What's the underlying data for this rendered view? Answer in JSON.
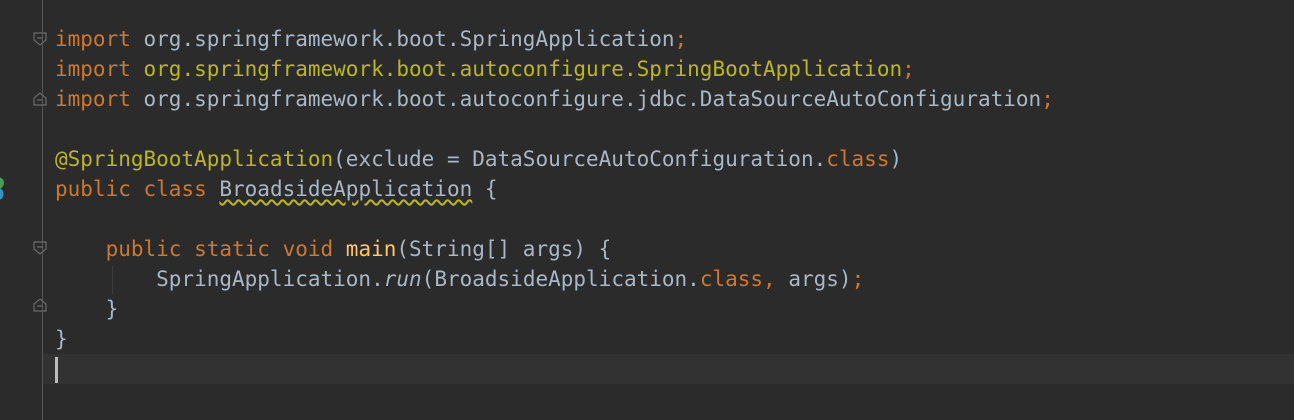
{
  "editor": {
    "lines": [
      {
        "id": "import1",
        "parts": [
          {
            "cls": "kw",
            "text": "import "
          },
          {
            "cls": "sym",
            "text": "org.springframework.boot.SpringApplication"
          },
          {
            "cls": "kw",
            "text": ";"
          }
        ]
      },
      {
        "id": "import2",
        "parts": [
          {
            "cls": "kw",
            "text": "import "
          },
          {
            "cls": "import-highlight",
            "text": "org.springframework.boot.autoconfigure.SpringBootApplication"
          },
          {
            "cls": "kw",
            "text": ";"
          }
        ]
      },
      {
        "id": "import3",
        "parts": [
          {
            "cls": "kw",
            "text": "import "
          },
          {
            "cls": "sym",
            "text": "org.springframework.boot.autoconfigure.jdbc.DataSourceAutoConfiguration"
          },
          {
            "cls": "kw",
            "text": ";"
          }
        ]
      },
      {
        "id": "blank1",
        "parts": []
      },
      {
        "id": "annotation",
        "parts": [
          {
            "cls": "ann",
            "text": "@SpringBootApplication"
          },
          {
            "cls": "sym",
            "text": "(exclude = DataSourceAutoConfiguration."
          },
          {
            "cls": "kw",
            "text": "class"
          },
          {
            "cls": "sym",
            "text": ")"
          }
        ]
      },
      {
        "id": "class-decl",
        "parts": [
          {
            "cls": "kw",
            "text": "public class "
          },
          {
            "cls": "sym warn",
            "text": "BroadsideApplication"
          },
          {
            "cls": "sym",
            "text": " {"
          }
        ]
      },
      {
        "id": "blank2",
        "parts": []
      },
      {
        "id": "main-decl",
        "parts": [
          {
            "cls": "sym",
            "text": "    "
          },
          {
            "cls": "kw",
            "text": "public static void "
          },
          {
            "cls": "method",
            "text": "main"
          },
          {
            "cls": "sym",
            "text": "(String[] args) {"
          }
        ]
      },
      {
        "id": "run-call",
        "parts": [
          {
            "cls": "sym",
            "text": "        SpringApplication."
          },
          {
            "cls": "static-call",
            "text": "run"
          },
          {
            "cls": "sym",
            "text": "(BroadsideApplication."
          },
          {
            "cls": "kw",
            "text": "class"
          },
          {
            "cls": "kw",
            "text": ", "
          },
          {
            "cls": "sym",
            "text": "args)"
          },
          {
            "cls": "kw",
            "text": ";"
          }
        ]
      },
      {
        "id": "main-close",
        "parts": [
          {
            "cls": "sym",
            "text": "    }"
          }
        ]
      },
      {
        "id": "class-close",
        "parts": [
          {
            "cls": "sym",
            "text": "}"
          }
        ]
      },
      {
        "id": "cursor-line",
        "parts": [],
        "current": true
      }
    ]
  },
  "icons": {
    "run": "run-gutter-icon",
    "fold": "fold-marker-icon"
  },
  "colors": {
    "background": "#2b2b2b",
    "keyword": "#cc7832",
    "annotation": "#bbb529",
    "text": "#a9b7c6",
    "method": "#ffc66d"
  }
}
